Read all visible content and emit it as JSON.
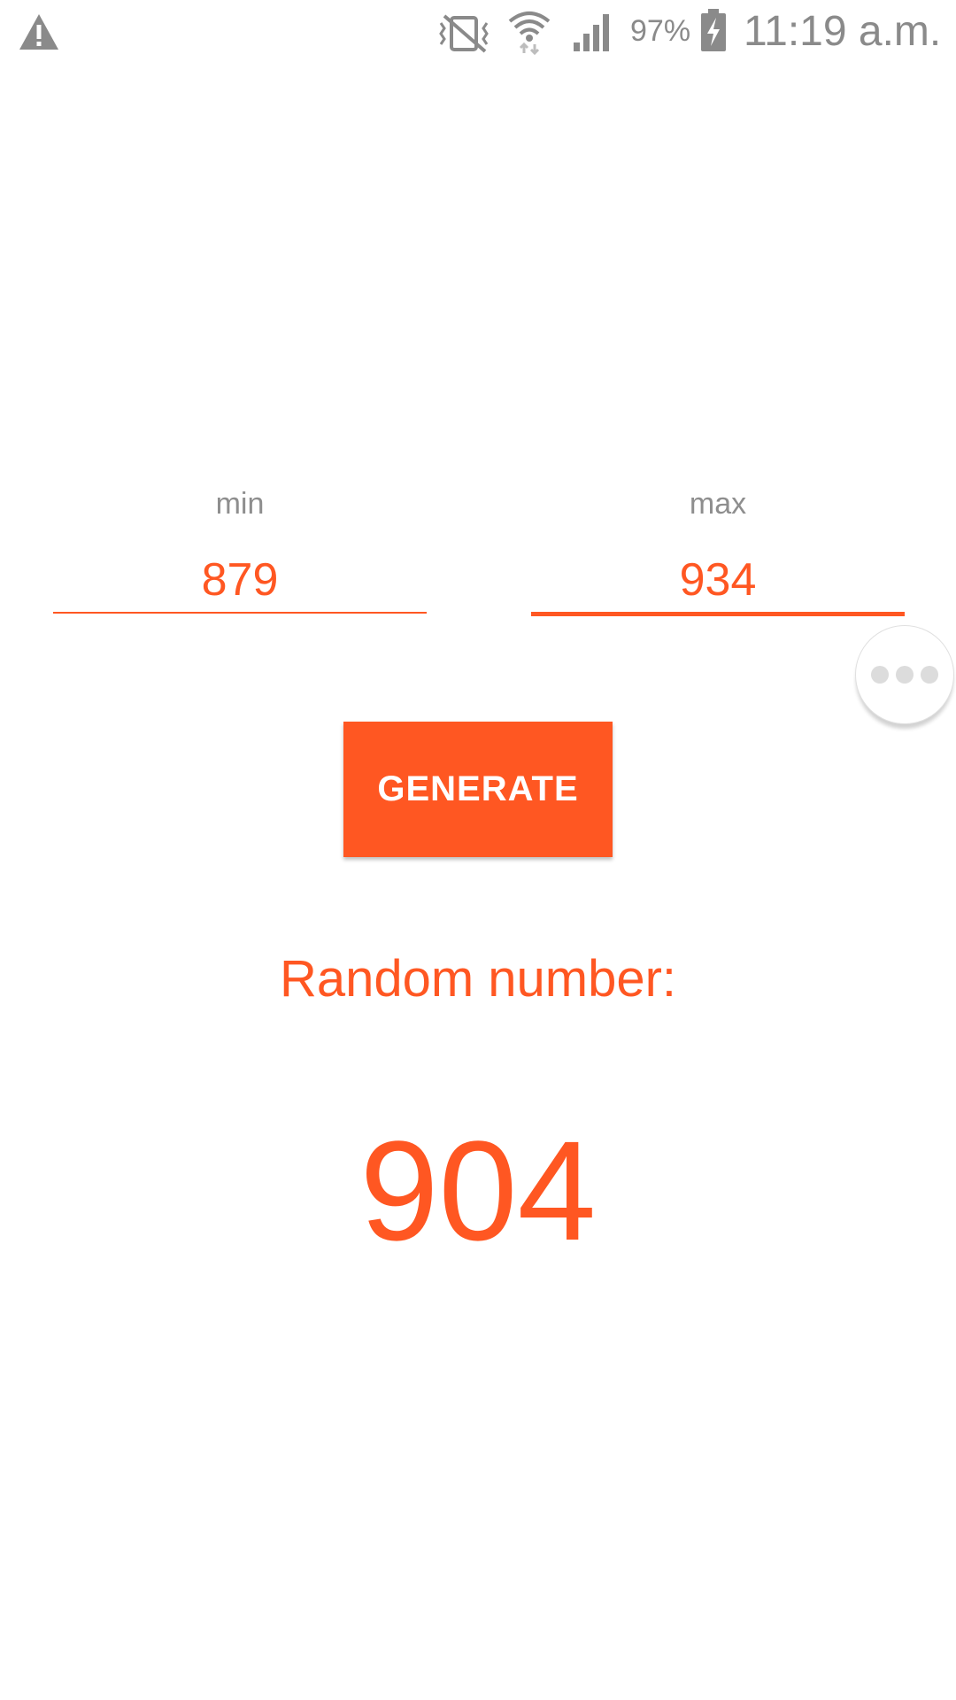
{
  "status_bar": {
    "icons": [
      "warning-icon",
      "vibrate-off-icon",
      "wifi-icon",
      "signal-icon",
      "battery-charging-icon"
    ],
    "battery_percent": "97%",
    "time": "11:19 a.m."
  },
  "form": {
    "min": {
      "label": "min",
      "value": "879"
    },
    "max": {
      "label": "max",
      "value": "934"
    }
  },
  "generate_button": {
    "label": "GENERATE"
  },
  "result": {
    "label": "Random number:",
    "value": "904"
  },
  "floating_menu": {
    "icon": "more-dots-icon"
  },
  "colors": {
    "accent": "#ff5722",
    "label_gray": "#8e8e8e",
    "status_gray": "#8a8a8a",
    "background": "#ffffff"
  }
}
